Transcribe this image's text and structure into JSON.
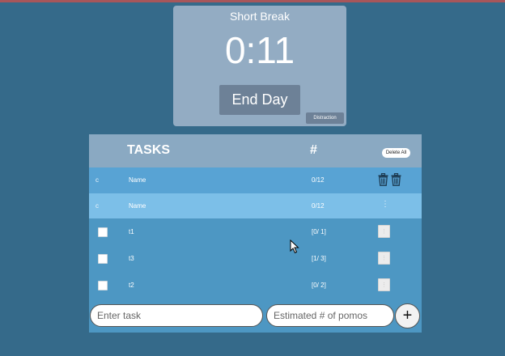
{
  "timer": {
    "mode": "Short Break",
    "time": "0:11",
    "end_day_label": "End Day",
    "distraction_label": "Distraction"
  },
  "tasks": {
    "title": "TASKS",
    "count_header": "#",
    "delete_all_label": "Delete All",
    "header_rows": [
      {
        "letter": "c",
        "name": "Name",
        "count": "0/12"
      },
      {
        "letter": "c",
        "name": "Name",
        "count": "0/12",
        "menu": "⋮"
      }
    ],
    "items": [
      {
        "name": "t1",
        "count": "[0/ 1]",
        "menu": "⋮"
      },
      {
        "name": "t3",
        "count": "[1/ 3]",
        "menu": "⋮"
      },
      {
        "name": "t2",
        "count": "[0/ 2]",
        "menu": "⋮"
      }
    ]
  },
  "inputs": {
    "task_placeholder": "Enter task",
    "pomos_placeholder": "Estimated # of pomos",
    "add_label": "+"
  },
  "colors": {
    "background": "#356a8a",
    "timer_card": "#93acc3",
    "button": "#6d8197",
    "table_header": "#8aa9c2",
    "row_primary": "#58a3d4",
    "row_highlight": "#7cbfe8",
    "row_task": "#4d97c3"
  },
  "icons": [
    "trash-icon",
    "vertical-dots-icon",
    "plus-icon",
    "mouse-cursor-icon"
  ]
}
